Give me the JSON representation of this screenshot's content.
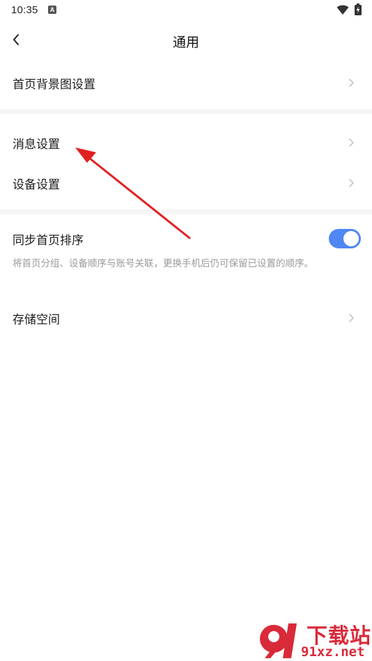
{
  "status_bar": {
    "time": "10:35",
    "notification_icon": "a-badge-icon",
    "wifi_icon": "wifi-icon",
    "battery_icon": "battery-charging-icon"
  },
  "header": {
    "back_icon": "chevron-left-icon",
    "title": "通用"
  },
  "settings": {
    "home_background": "首页背景图设置",
    "message_settings": "消息设置",
    "device_settings": "设备设置",
    "sync_home_order": {
      "label": "同步首页排序",
      "enabled": true,
      "description": "将首页分组、设备顺序与账号关联，更换手机后仍可保留已设置的顺序。"
    },
    "storage": "存储空间"
  },
  "colors": {
    "toggle_on": "#4f87f3",
    "annotation_arrow": "#e02020",
    "watermark": "#d92a3a",
    "divider": "#f5f5f5"
  },
  "watermark": {
    "top": "下载站",
    "bottom": "91xz.net"
  }
}
